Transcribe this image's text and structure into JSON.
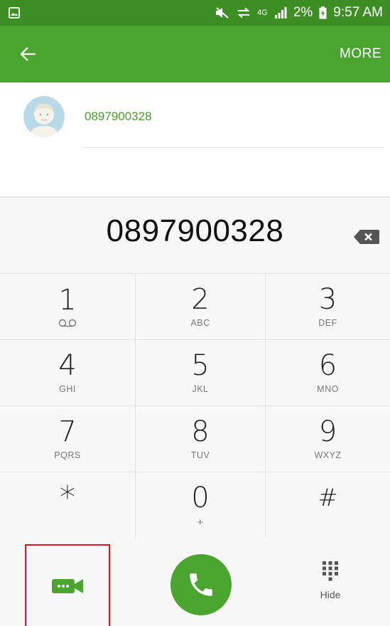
{
  "status_bar": {
    "network": "4G",
    "battery": "2%",
    "time": "9:57 AM"
  },
  "action_bar": {
    "more_label": "MORE"
  },
  "contact_suggestion": {
    "number": "0897900328"
  },
  "dialer": {
    "dialed_number": "0897900328"
  },
  "keypad": [
    {
      "digit": "1",
      "letters": ""
    },
    {
      "digit": "2",
      "letters": "ABC"
    },
    {
      "digit": "3",
      "letters": "DEF"
    },
    {
      "digit": "4",
      "letters": "GHI"
    },
    {
      "digit": "5",
      "letters": "JKL"
    },
    {
      "digit": "6",
      "letters": "MNO"
    },
    {
      "digit": "7",
      "letters": "PQRS"
    },
    {
      "digit": "8",
      "letters": "TUV"
    },
    {
      "digit": "9",
      "letters": "WXYZ"
    },
    {
      "digit": "*",
      "letters": ""
    },
    {
      "digit": "0",
      "letters": "+"
    },
    {
      "digit": "#",
      "letters": ""
    }
  ],
  "bottom_bar": {
    "hide_label": "Hide"
  },
  "colors": {
    "status_bar": "#3e8f23",
    "action_bar": "#4aa52e",
    "accent_green": "#4aa52e",
    "highlight_red": "#d9181e"
  },
  "icons": [
    "gallery-notification-icon",
    "mute-icon",
    "data-sync-icon",
    "signal-icon",
    "battery-charging-icon",
    "back-arrow-icon",
    "avatar",
    "backspace-icon",
    "voicemail-icon",
    "video-call-icon",
    "phone-icon",
    "dialpad-icon"
  ]
}
